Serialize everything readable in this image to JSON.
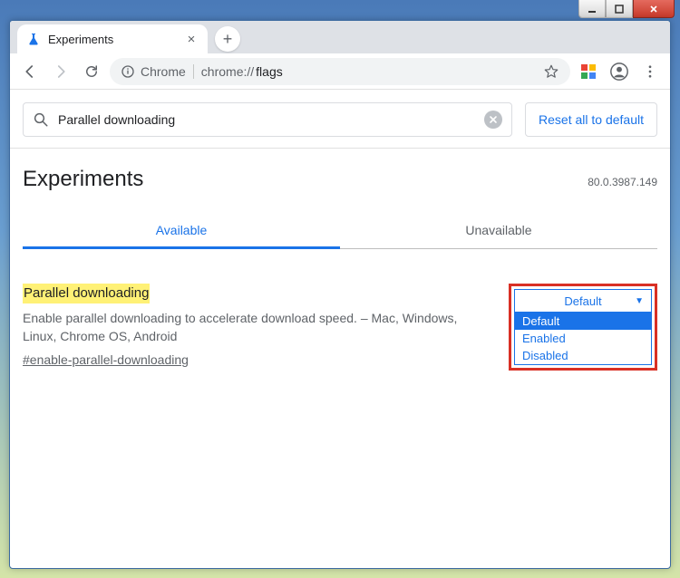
{
  "window": {
    "tab_title": "Experiments"
  },
  "toolbar": {
    "security_label": "Chrome",
    "url_scheme": "chrome://",
    "url_path": "flags"
  },
  "search": {
    "value": "Parallel downloading"
  },
  "reset_button_label": "Reset all to default",
  "page_title": "Experiments",
  "version": "80.0.3987.149",
  "tabs": {
    "available": "Available",
    "unavailable": "Unavailable"
  },
  "flag": {
    "title": "Parallel downloading",
    "description": "Enable parallel downloading to accelerate download speed. – Mac, Windows, Linux, Chrome OS, Android",
    "anchor": "#enable-parallel-downloading",
    "selected": "Default",
    "options": [
      "Default",
      "Enabled",
      "Disabled"
    ]
  }
}
